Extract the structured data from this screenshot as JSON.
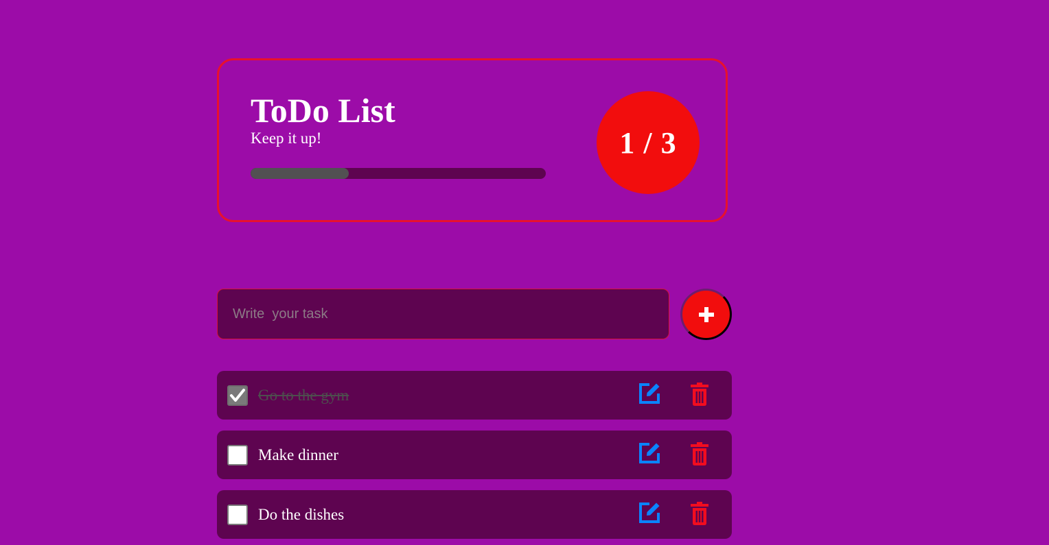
{
  "header": {
    "title": "ToDo List",
    "subtitle": "Keep it up!",
    "progress_fraction": 0.3333,
    "counter_text": "1 / 3"
  },
  "form": {
    "placeholder": "Write  your task",
    "value": "",
    "add_label": "+",
    "add_icon": "plus-icon"
  },
  "tasks": [
    {
      "label": "Go to the gym",
      "completed": true,
      "edit_icon": "edit-icon",
      "delete_icon": "trash-icon"
    },
    {
      "label": "Make dinner",
      "completed": false,
      "edit_icon": "edit-icon",
      "delete_icon": "trash-icon"
    },
    {
      "label": "Do the dishes",
      "completed": false,
      "edit_icon": "edit-icon",
      "delete_icon": "trash-icon"
    }
  ],
  "colors": {
    "background": "#9c0ca8",
    "accent": "#f20d0d",
    "panel": "#5e0450",
    "edit_icon": "#0a84ff",
    "delete_icon": "#f20d1f",
    "progress": "#525052"
  }
}
